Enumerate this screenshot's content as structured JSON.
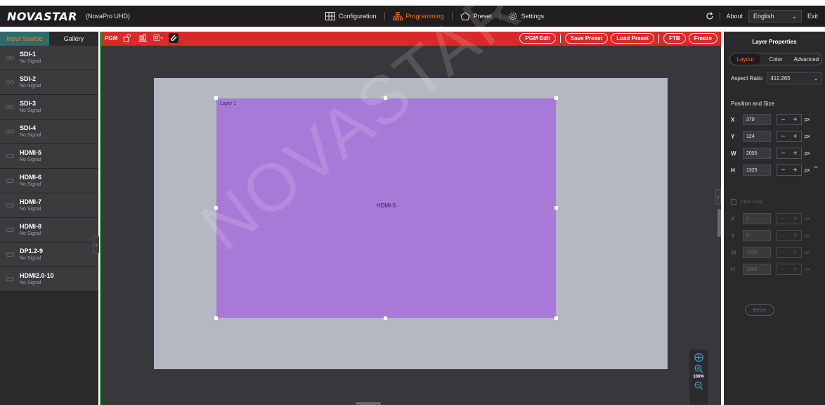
{
  "header": {
    "logo": "NOVASTAR",
    "product": "(NovaPro UHD)",
    "nav": [
      {
        "label": "Configuration",
        "icon": "grid-icon"
      },
      {
        "label": "Programming",
        "icon": "hierarchy-icon",
        "active": true
      },
      {
        "label": "Preset",
        "icon": "preset-icon"
      },
      {
        "label": "Settings",
        "icon": "gear-icon"
      }
    ],
    "about": "About",
    "language": "English",
    "exit": "Exit"
  },
  "left_panel": {
    "tabs": [
      "Input Source",
      "Gallery"
    ],
    "sources": [
      {
        "name": "SDI-1",
        "status": "No Signal",
        "icon": "sdi-icon"
      },
      {
        "name": "SDI-2",
        "status": "No Signal",
        "icon": "sdi-icon"
      },
      {
        "name": "SDI-3",
        "status": "No Signal",
        "icon": "sdi-icon"
      },
      {
        "name": "SDI-4",
        "status": "No Signal",
        "icon": "sdi-icon"
      },
      {
        "name": "HDMI-5",
        "status": "No Signal",
        "icon": "hdmi-icon"
      },
      {
        "name": "HDMI-6",
        "status": "No Signal",
        "icon": "hdmi-icon"
      },
      {
        "name": "HDMI-7",
        "status": "No Signal",
        "icon": "hdmi-icon"
      },
      {
        "name": "HDMI-8",
        "status": "No Signal",
        "icon": "hdmi-icon"
      },
      {
        "name": "DP1.2-9",
        "status": "No Signal",
        "icon": "dp-icon"
      },
      {
        "name": "HDMI2.0-10",
        "status": "No Signal",
        "icon": "hdmi-icon"
      }
    ]
  },
  "pgm": {
    "label": "PGM",
    "buttons": [
      "PGM Edit",
      "Save Preset",
      "Load Preset",
      "FTB",
      "Freeze"
    ]
  },
  "canvas": {
    "layer_name": "Layer 1",
    "layer_source": "HDMI-5",
    "zoom": "100%"
  },
  "properties": {
    "title": "Layer Properties",
    "tabs": [
      "Layout",
      "Color",
      "Advanced"
    ],
    "aspect_label": "Aspect Ratio",
    "aspect_value": "411:265",
    "position_title": "Position and Size",
    "fields": [
      {
        "label": "X",
        "value": "379",
        "unit": "px"
      },
      {
        "label": "Y",
        "value": "124",
        "unit": "px"
      },
      {
        "label": "W",
        "value": "2055",
        "unit": "px"
      },
      {
        "label": "H",
        "value": "1325",
        "unit": "px"
      }
    ],
    "crop_label": "Input Crop",
    "crop_fields": [
      {
        "label": "X",
        "value": "0",
        "unit": "px"
      },
      {
        "label": "Y",
        "value": "0",
        "unit": "px"
      },
      {
        "label": "W",
        "value": "1920",
        "unit": "px"
      },
      {
        "label": "H",
        "value": "1080",
        "unit": "px"
      }
    ],
    "reset": "Reset"
  },
  "watermark": "NOVASTAR TECH CO.,",
  "colors": {
    "accent": "#ff6a1a",
    "pgm_red": "#d92a2a",
    "layer_purple": "#a77ad8",
    "screen_gray": "#b3b8c2"
  }
}
